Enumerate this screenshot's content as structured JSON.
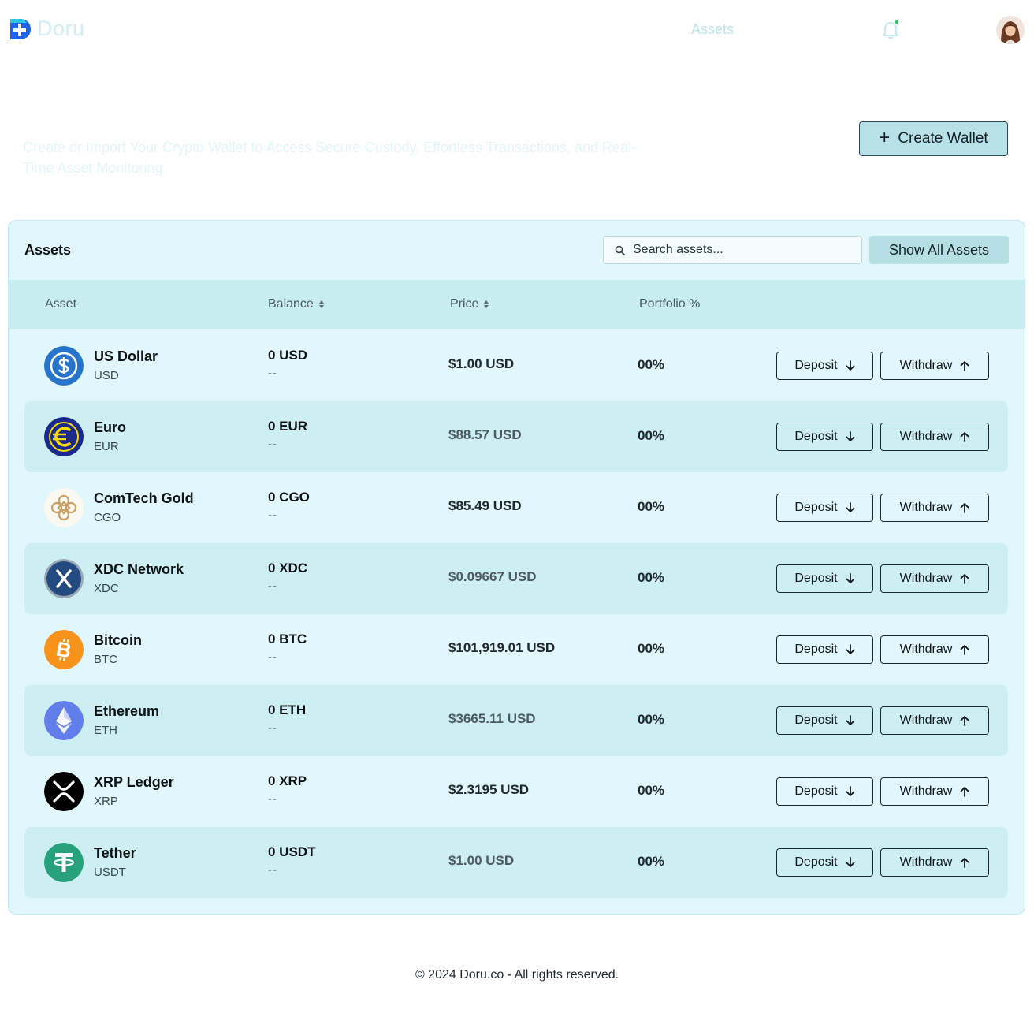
{
  "brand": {
    "name": "Doru"
  },
  "nav": {
    "assets_link": "Assets"
  },
  "hero": {
    "description": "Create or Import Your Crypto Wallet to Access Secure Custody, Effortless Transactions, and Real-Time Asset Monitoring",
    "create_wallet_label": "Create Wallet"
  },
  "panel": {
    "title": "Assets",
    "search_placeholder": "Search assets...",
    "show_all_label": "Show All Assets",
    "columns": {
      "asset": "Asset",
      "balance": "Balance",
      "price": "Price",
      "portfolio": "Portfolio %"
    }
  },
  "assets": [
    {
      "name": "US Dollar",
      "symbol": "USD",
      "balance": "0 USD",
      "balance_sub": "--",
      "price": "$1.00 USD",
      "portfolio": "00%",
      "icon": "usd-coin-icon",
      "color": "#2775ca"
    },
    {
      "name": "Euro",
      "symbol": "EUR",
      "balance": "0 EUR",
      "balance_sub": "--",
      "price": "$88.57 USD",
      "portfolio": "00%",
      "icon": "euro-coin-icon",
      "color": "#1b2a8a"
    },
    {
      "name": "ComTech Gold",
      "symbol": "CGO",
      "balance": "0 CGO",
      "balance_sub": "--",
      "price": "$85.49 USD",
      "portfolio": "00%",
      "icon": "comtech-gold-icon",
      "color": "#c9a063"
    },
    {
      "name": "XDC Network",
      "symbol": "XDC",
      "balance": "0 XDC",
      "balance_sub": "--",
      "price": "$0.09667 USD",
      "portfolio": "00%",
      "icon": "xdc-icon",
      "color": "#244b81"
    },
    {
      "name": "Bitcoin",
      "symbol": "BTC",
      "balance": "0 BTC",
      "balance_sub": "--",
      "price": "$101,919.01 USD",
      "portfolio": "00%",
      "icon": "bitcoin-icon",
      "color": "#f7931a"
    },
    {
      "name": "Ethereum",
      "symbol": "ETH",
      "balance": "0 ETH",
      "balance_sub": "--",
      "price": "$3665.11 USD",
      "portfolio": "00%",
      "icon": "ethereum-icon",
      "color": "#627eea"
    },
    {
      "name": "XRP Ledger",
      "symbol": "XRP",
      "balance": "0 XRP",
      "balance_sub": "--",
      "price": "$2.3195 USD",
      "portfolio": "00%",
      "icon": "xrp-icon",
      "color": "#000000"
    },
    {
      "name": "Tether",
      "symbol": "USDT",
      "balance": "0 USDT",
      "balance_sub": "--",
      "price": "$1.00 USD",
      "portfolio": "00%",
      "icon": "tether-icon",
      "color": "#26a17b"
    }
  ],
  "actions": {
    "deposit_label": "Deposit",
    "withdraw_label": "Withdraw"
  },
  "footer": {
    "copyright": "© 2024 Doru.co - All rights reserved."
  }
}
